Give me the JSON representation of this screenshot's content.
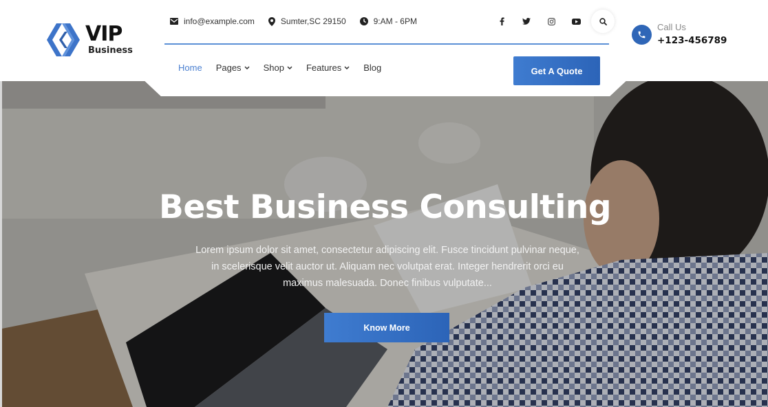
{
  "brand": {
    "name": "VIP",
    "tagline": "Business",
    "accent_color": "#2f66b7"
  },
  "topbar": {
    "email": {
      "icon": "envelope-icon",
      "text": "info@example.com"
    },
    "location": {
      "icon": "map-pin-icon",
      "text": "Sumter,SC 29150"
    },
    "hours": {
      "icon": "clock-icon",
      "text": "9:AM - 6PM"
    },
    "socials": [
      {
        "name": "facebook",
        "icon": "facebook-icon"
      },
      {
        "name": "twitter",
        "icon": "twitter-icon"
      },
      {
        "name": "instagram",
        "icon": "instagram-icon"
      },
      {
        "name": "youtube",
        "icon": "youtube-icon"
      }
    ],
    "search_icon": "search-icon"
  },
  "call": {
    "label": "Call Us",
    "number": "+123-456789",
    "icon": "phone-icon"
  },
  "nav": {
    "items": [
      {
        "label": "Home",
        "active": true,
        "dropdown": false
      },
      {
        "label": "Pages",
        "active": false,
        "dropdown": true
      },
      {
        "label": "Shop",
        "active": false,
        "dropdown": true
      },
      {
        "label": "Features",
        "active": false,
        "dropdown": true
      },
      {
        "label": "Blog",
        "active": false,
        "dropdown": false
      }
    ],
    "cta_label": "Get A Quote"
  },
  "hero": {
    "title": "Best Business Consulting",
    "text": "Lorem ipsum dolor sit amet, consectetur adipiscing elit. Fusce tincidunt pulvinar neque, in scelerisque velit auctor ut. Aliquam nec volutpat erat. Integer hendrerit orci eu maximus malesuada. Donec finibus vulputate...",
    "button_label": "Know More"
  }
}
